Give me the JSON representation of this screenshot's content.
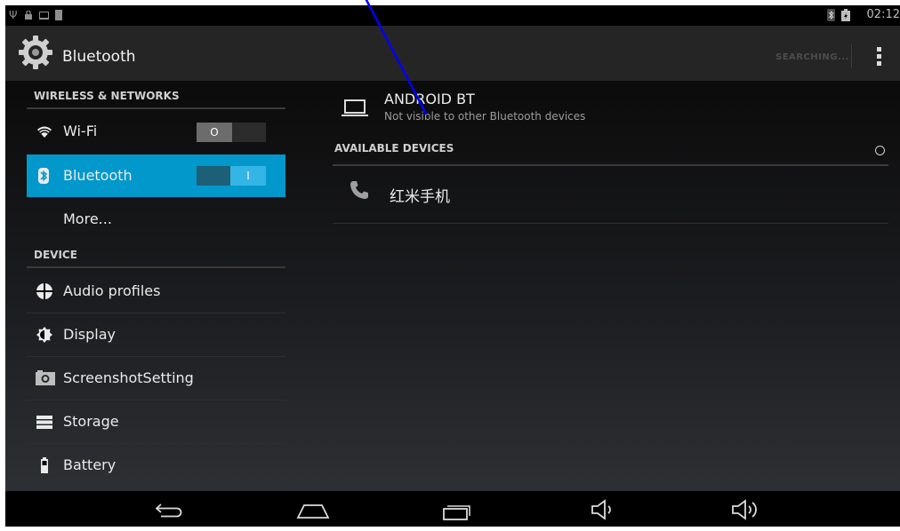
{
  "status_bar": {
    "time": "02:12",
    "icons": [
      "usb-icon",
      "lock-icon",
      "screen-icon",
      "sdcard-icon",
      "bluetooth-status-icon",
      "battery-icon"
    ]
  },
  "action_bar": {
    "title": "Bluetooth",
    "app_icon": "settings-gear-icon",
    "status_action": "SEARCHING...",
    "overflow_icon": "overflow-menu-icon"
  },
  "left_pane": {
    "section_wireless": "WIRELESS & NETWORKS",
    "wifi": {
      "label": "Wi-Fi",
      "icon": "wifi-icon",
      "toggle": "O",
      "enabled": false
    },
    "bluetooth": {
      "label": "Bluetooth",
      "icon": "bluetooth-icon",
      "toggle": "I",
      "enabled": true,
      "selected": true
    },
    "more": {
      "label": "More..."
    },
    "section_device": "DEVICE",
    "device_items": [
      {
        "label": "Audio profiles",
        "icon": "audio-profiles-icon"
      },
      {
        "label": "Display",
        "icon": "display-icon"
      },
      {
        "label": "ScreenshotSetting",
        "icon": "camera-icon"
      },
      {
        "label": "Storage",
        "icon": "storage-icon"
      },
      {
        "label": "Battery",
        "icon": "battery-icon"
      }
    ]
  },
  "right_pane": {
    "device_name": "ANDROID BT",
    "device_status": "Not visible to other Bluetooth devices",
    "available_header": "AVAILABLE DEVICES",
    "devices": [
      {
        "name": "红米手机",
        "icon": "phone-icon"
      }
    ]
  },
  "nav_bar": {
    "icons": [
      "back-icon",
      "home-icon",
      "recent-apps-icon",
      "volume-down-icon",
      "volume-up-icon"
    ]
  },
  "colors": {
    "accent": "#33b5e5",
    "selected_row": "#0398cb",
    "annotation": "#0000ff"
  }
}
